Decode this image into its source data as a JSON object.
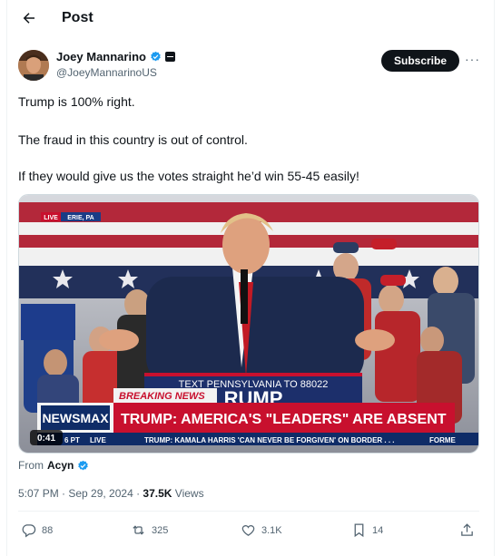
{
  "header": {
    "title": "Post"
  },
  "author": {
    "name": "Joey Mannarino",
    "handle": "@JoeyMannarinoUS",
    "subscribe_label": "Subscribe",
    "more_label": "···"
  },
  "tweet": {
    "lines": [
      "Trump is 100% right.",
      "The fraud in this country is out of control.",
      "If they would give us the votes straight he’d win 55-45 easily!"
    ]
  },
  "video": {
    "live_label": "LIVE",
    "location": "ERIE, PA",
    "podium_text": "TEXT PENNSYLVANIA TO 88022",
    "podium_big": "RUMP",
    "breaking_label": "BREAKING NEWS",
    "network": "NEWSMAX",
    "headline": "TRUMP: AMERICA'S \"LEADERS\" ARE ABSENT",
    "time_label": "6 PT",
    "live_small": "LIVE",
    "ticker": "TRUMP: KAMALA HARRIS 'CAN NEVER BE FORGIVEN' ON BORDER . . .",
    "ticker_right": "FORME",
    "duration": "0:41"
  },
  "attribution": {
    "prefix": "From",
    "source": "Acyn"
  },
  "meta": {
    "time": "5:07 PM · Sep 29, 2024 · ",
    "views_count": "37.5K",
    "views_label": " Views"
  },
  "actions": {
    "replies": "88",
    "reposts": "325",
    "likes": "3.1K",
    "bookmarks": "14"
  },
  "colors": {
    "verified": "#1d9bf0",
    "accent_red": "#c8102e",
    "network_blue": "#0f2c67"
  },
  "icons": [
    "back-arrow-icon",
    "verified-icon",
    "reply-icon",
    "repost-icon",
    "like-icon",
    "bookmark-icon",
    "share-icon"
  ]
}
